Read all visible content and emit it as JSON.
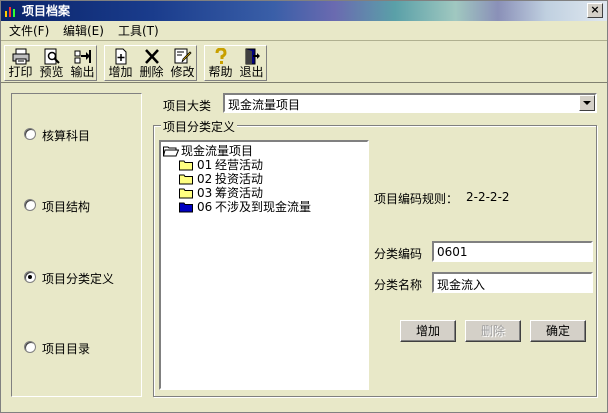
{
  "window": {
    "title": "项目档案",
    "close_glyph": "×"
  },
  "menu": [
    {
      "label": "文件(F)"
    },
    {
      "label": "编辑(E)"
    },
    {
      "label": "工具(T)"
    }
  ],
  "toolbar": {
    "print": "打印",
    "preview": "预览",
    "export": "输出",
    "add": "增加",
    "delete": "删除",
    "modify": "修改",
    "help": "帮助",
    "exit": "退出"
  },
  "left_options": [
    {
      "label": "核算科目",
      "checked": false
    },
    {
      "label": "项目结构",
      "checked": false
    },
    {
      "label": "项目分类定义",
      "checked": true
    },
    {
      "label": "项目目录",
      "checked": false
    }
  ],
  "category": {
    "label": "项目大类",
    "value": "现金流量项目"
  },
  "group_title": "项目分类定义",
  "tree": {
    "root": "现金流量项目",
    "children": [
      {
        "code": "01",
        "name": "经营活动",
        "icon": "folder-yellow"
      },
      {
        "code": "02",
        "name": "投资活动",
        "icon": "folder-yellow"
      },
      {
        "code": "03",
        "name": "筹资活动",
        "icon": "folder-yellow"
      },
      {
        "code": "06",
        "name": "不涉及到现金流量",
        "icon": "folder-blue"
      }
    ]
  },
  "coding_rule": {
    "label": "项目编码规则：",
    "value": "2-2-2-2"
  },
  "fields": {
    "code_label": "分类编码",
    "code_value": "0601",
    "name_label": "分类名称",
    "name_value": "现金流入"
  },
  "buttons": {
    "add": "增加",
    "delete": "删除",
    "confirm": "确定"
  }
}
